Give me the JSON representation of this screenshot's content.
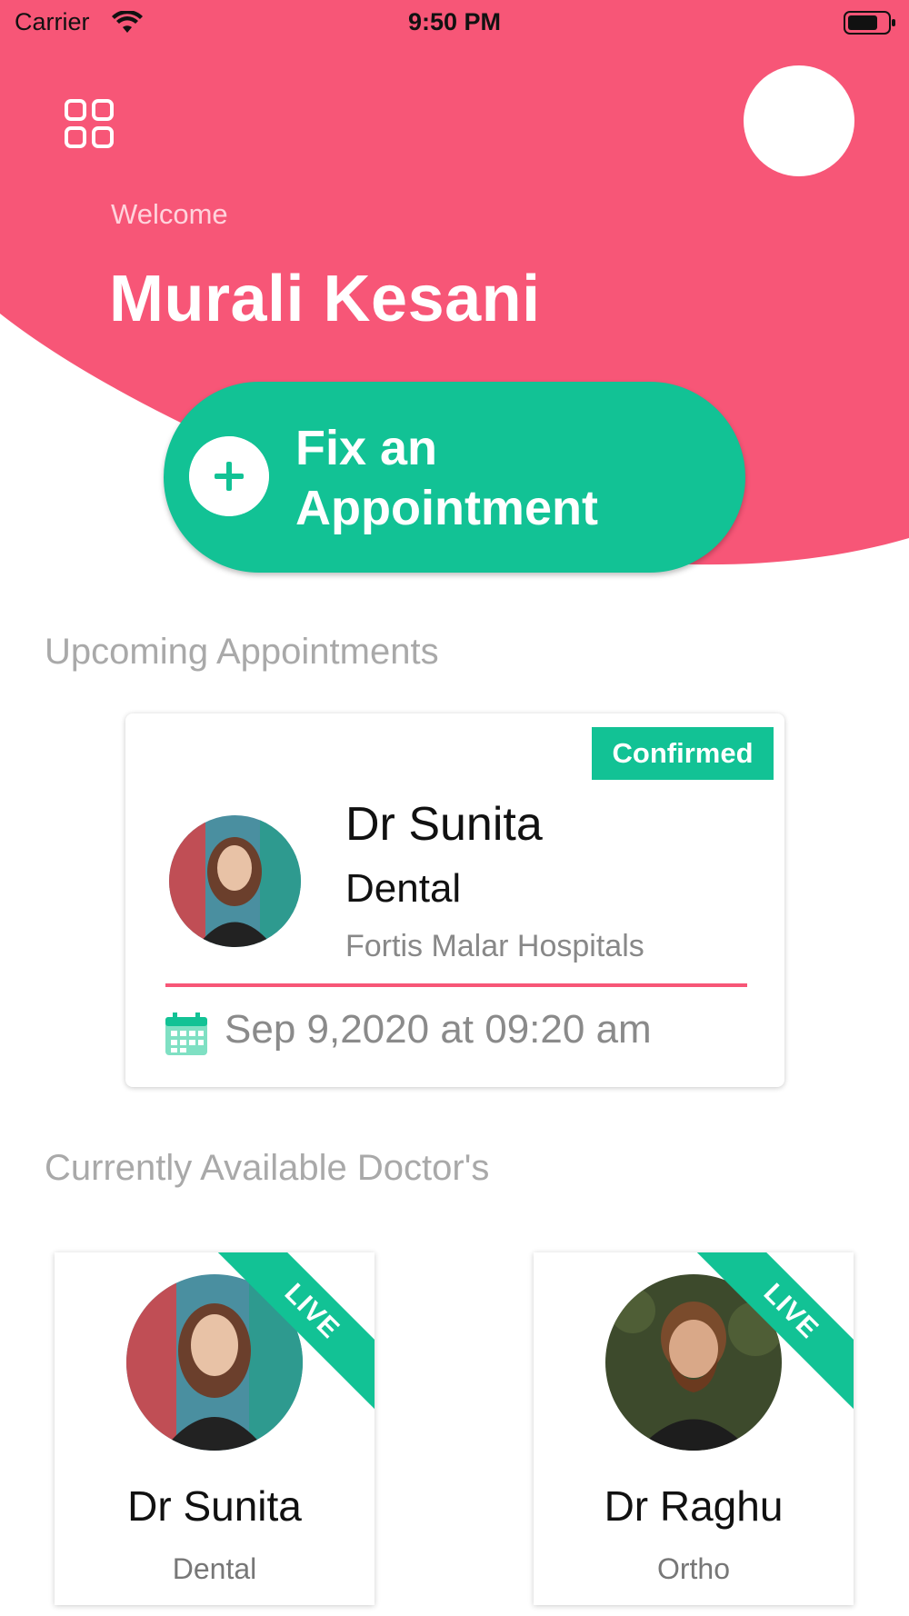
{
  "status_bar": {
    "carrier": "Carrier",
    "time": "9:50 PM"
  },
  "header": {
    "welcome": "Welcome",
    "user_name": "Murali Kesani",
    "menu_icon": "grid-menu-icon",
    "avatar_icon": "profile-avatar"
  },
  "fix_button": {
    "line1": "Fix an",
    "line2": "Appointment",
    "icon": "plus-icon"
  },
  "upcoming": {
    "title": "Upcoming Appointments",
    "card": {
      "status": "Confirmed",
      "doctor_name": "Dr Sunita",
      "specialty": "Dental",
      "hospital": "Fortis Malar Hospitals",
      "datetime": "Sep 9,2020 at 09:20 am",
      "calendar_icon": "calendar-icon"
    }
  },
  "available": {
    "title": "Currently Available Doctor's",
    "doctors": [
      {
        "name": "Dr Sunita",
        "specialty": "Dental",
        "badge": "LIVE"
      },
      {
        "name": "Dr Raghu",
        "specialty": "Ortho",
        "badge": "LIVE"
      }
    ]
  },
  "colors": {
    "brand_pink": "#f75677",
    "accent_green": "#12c295"
  }
}
